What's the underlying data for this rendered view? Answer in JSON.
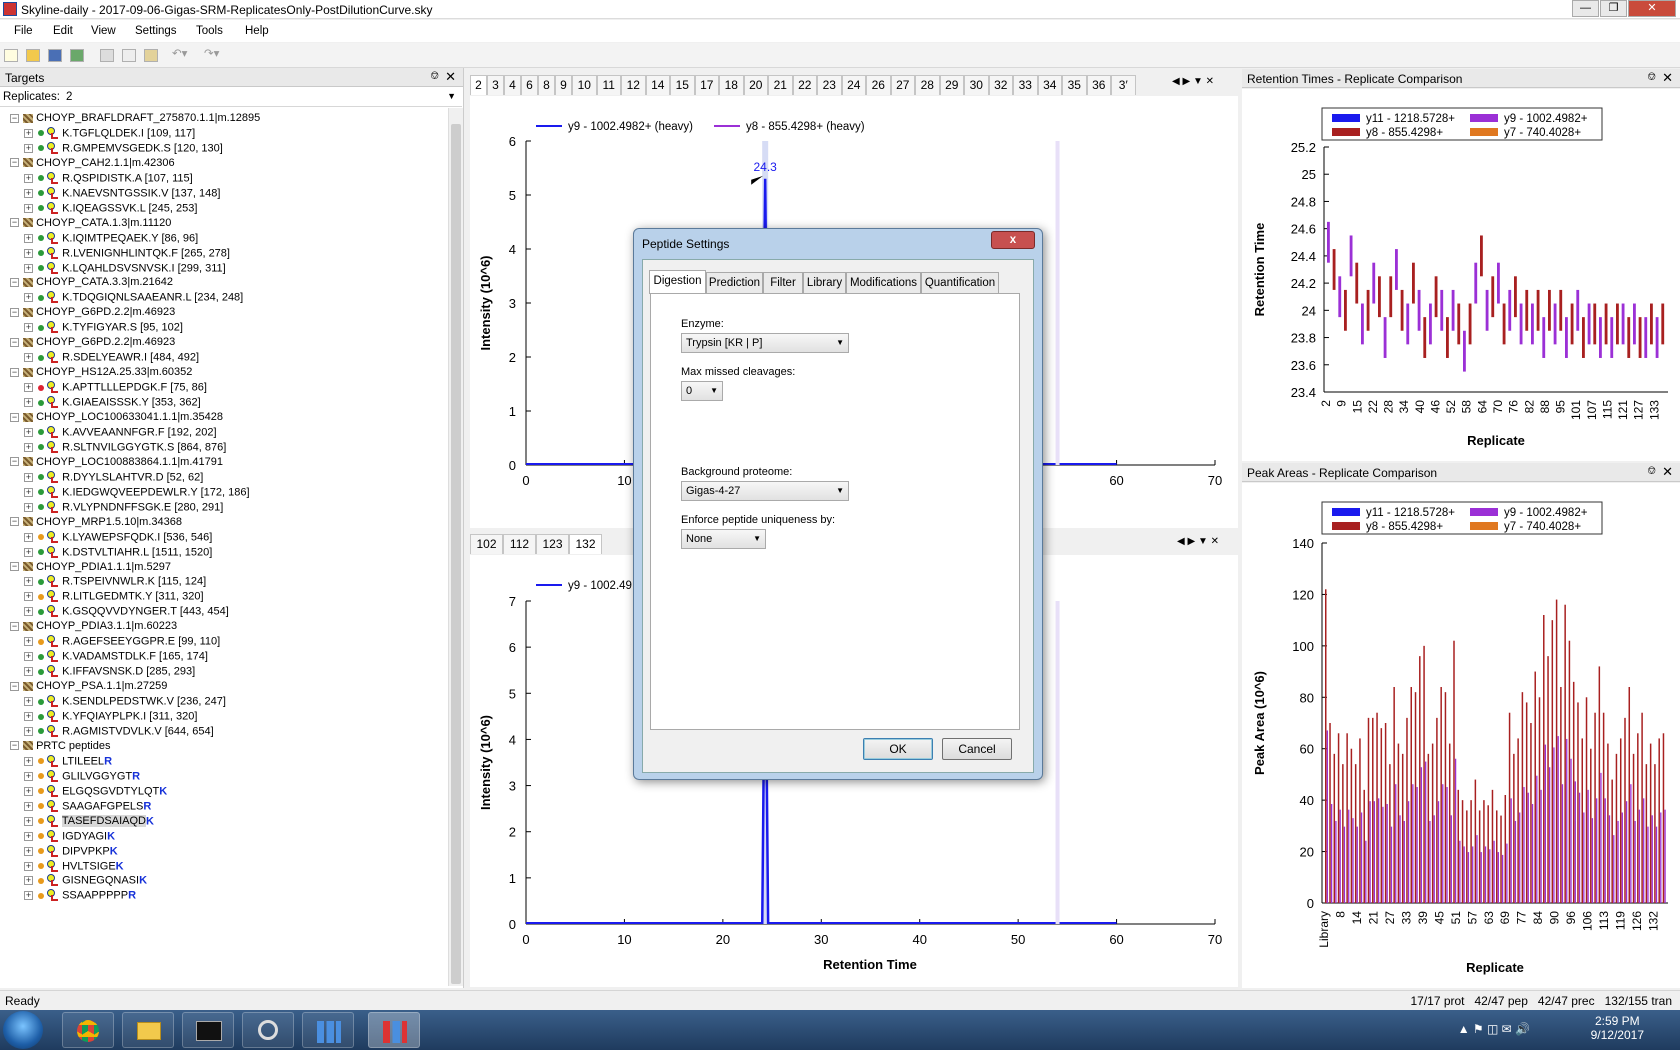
{
  "window": {
    "title": "Skyline-daily - 2017-09-06-Gigas-SRM-ReplicatesOnly-PostDilutionCurve.sky"
  },
  "menu": [
    "File",
    "Edit",
    "View",
    "Settings",
    "Tools",
    "Help"
  ],
  "targets": {
    "title": "Targets",
    "replicates_label": "Replicates:",
    "replicates_value": "2"
  },
  "tree": [
    {
      "kind": "prot",
      "text": "CHOYP_BRAFLDRAFT_275870.1.1|m.12895"
    },
    {
      "kind": "pep",
      "dot": "g",
      "text": "K.TGFLQLDEK.I [109, 117]"
    },
    {
      "kind": "pep",
      "dot": "g",
      "text": "R.GMPEMVSGEDK.S [120, 130]"
    },
    {
      "kind": "prot",
      "text": "CHOYP_CAH2.1.1|m.42306"
    },
    {
      "kind": "pep",
      "dot": "g",
      "text": "R.QSPIDISTK.A [107, 115]"
    },
    {
      "kind": "pep",
      "dot": "g",
      "text": "K.NAEVSNTGSSIK.V [137, 148]"
    },
    {
      "kind": "pep",
      "dot": "g",
      "text": "K.IQEAGSSVK.L [245, 253]"
    },
    {
      "kind": "prot",
      "text": "CHOYP_CATA.1.3|m.11120"
    },
    {
      "kind": "pep",
      "dot": "g",
      "text": "K.IQIMTPEQAEK.Y [86, 96]"
    },
    {
      "kind": "pep",
      "dot": "g",
      "text": "R.LVENIGNHLINTQK.F [265, 278]"
    },
    {
      "kind": "pep",
      "dot": "g",
      "text": "K.LQAHLDSVSNVSK.I [299, 311]"
    },
    {
      "kind": "prot",
      "text": "CHOYP_CATA.3.3|m.21642"
    },
    {
      "kind": "pep",
      "dot": "g",
      "text": "K.TDQGIQNLSAAEANR.L [234, 248]"
    },
    {
      "kind": "prot",
      "text": "CHOYP_G6PD.2.2|m.46923"
    },
    {
      "kind": "pep",
      "dot": "g",
      "text": "K.TYFIGYAR.S [95, 102]"
    },
    {
      "kind": "prot",
      "text": "CHOYP_G6PD.2.2|m.46923"
    },
    {
      "kind": "pep",
      "dot": "g",
      "text": "R.SDELYEAWR.I [484, 492]"
    },
    {
      "kind": "prot",
      "text": "CHOYP_HS12A.25.33|m.60352"
    },
    {
      "kind": "pep",
      "dot": "r",
      "text": "K.APTTLLLEPDGK.F [75, 86]"
    },
    {
      "kind": "pep",
      "dot": "g",
      "text": "K.GIAEAISSSK.Y [353, 362]"
    },
    {
      "kind": "prot",
      "text": "CHOYP_LOC100633041.1.1|m.35428"
    },
    {
      "kind": "pep",
      "dot": "g",
      "text": "K.AVVEAANNFGR.F [192, 202]"
    },
    {
      "kind": "pep",
      "dot": "g",
      "text": "R.SLTNVILGGYGTK.S [864, 876]"
    },
    {
      "kind": "prot",
      "text": "CHOYP_LOC100883864.1.1|m.41791"
    },
    {
      "kind": "pep",
      "dot": "g",
      "text": "R.DYYLSLAHTVR.D [52, 62]"
    },
    {
      "kind": "pep",
      "dot": "g",
      "text": "K.IEDGWQVEEPDEWLR.Y [172, 186]"
    },
    {
      "kind": "pep",
      "dot": "g",
      "text": "R.VLYPNDNFFSGK.E [280, 291]"
    },
    {
      "kind": "prot",
      "text": "CHOYP_MRP1.5.10|m.34368"
    },
    {
      "kind": "pep",
      "dot": "o",
      "text": "K.LYAWEPSFQDK.I [536, 546]"
    },
    {
      "kind": "pep",
      "dot": "g",
      "text": "K.DSTVLTIAHR.L [1511, 1520]"
    },
    {
      "kind": "prot",
      "text": "CHOYP_PDIA1.1.1|m.5297"
    },
    {
      "kind": "pep",
      "dot": "g",
      "text": "R.TSPEIVNWLR.K [115, 124]"
    },
    {
      "kind": "pep",
      "dot": "o",
      "text": "R.LITLGEDMTK.Y [311, 320]"
    },
    {
      "kind": "pep",
      "dot": "g",
      "text": "K.GSQQVVDYNGER.T [443, 454]"
    },
    {
      "kind": "prot",
      "text": "CHOYP_PDIA3.1.1|m.60223"
    },
    {
      "kind": "pep",
      "dot": "o",
      "text": "R.AGEFSEEYGGPR.E [99, 110]"
    },
    {
      "kind": "pep",
      "dot": "g",
      "text": "K.VADAMSTDLK.F [165, 174]"
    },
    {
      "kind": "pep",
      "dot": "g",
      "text": "K.IFFAVSNSK.D [285, 293]"
    },
    {
      "kind": "prot",
      "text": "CHOYP_PSA.1.1|m.27259"
    },
    {
      "kind": "pep",
      "dot": "g",
      "text": "K.SENDLPEDSTWK.V [236, 247]"
    },
    {
      "kind": "pep",
      "dot": "g",
      "text": "K.YFQIAYPLPK.I [311, 320]"
    },
    {
      "kind": "pep",
      "dot": "g",
      "text": "R.AGMISTVDVLK.V [644, 654]"
    },
    {
      "kind": "prot",
      "text": "PRTC peptides"
    },
    {
      "kind": "prtc",
      "dot": "o",
      "text": "LTILEEL",
      "end": "R"
    },
    {
      "kind": "prtc",
      "dot": "o",
      "text": "GLILVGGYGT",
      "end": "R"
    },
    {
      "kind": "prtc",
      "dot": "o",
      "text": "ELGQSGVDTYLQT",
      "end": "K"
    },
    {
      "kind": "prtc",
      "dot": "o",
      "text": "SAAGAFGPELS",
      "end": "R"
    },
    {
      "kind": "prtc",
      "dot": "o",
      "text": "TASEFDSAIAQD",
      "end": "K",
      "sel": true
    },
    {
      "kind": "prtc",
      "dot": "o",
      "text": "IGDYAGI",
      "end": "K"
    },
    {
      "kind": "prtc",
      "dot": "o",
      "text": "DIPVPKP",
      "end": "K"
    },
    {
      "kind": "prtc",
      "dot": "o",
      "text": "HVLTSIGE",
      "end": "K"
    },
    {
      "kind": "prtc",
      "dot": "o",
      "text": "GISNEGQNASI",
      "end": "K"
    },
    {
      "kind": "prtc",
      "dot": "o",
      "text": "SSAAPPPPP",
      "end": "R"
    }
  ],
  "top_tabs": [
    "2",
    "3",
    "4",
    "6",
    "8",
    "9",
    "10",
    "11",
    "12",
    "14",
    "15",
    "17",
    "18",
    "20",
    "21",
    "22",
    "23",
    "24",
    "26",
    "27",
    "28",
    "29",
    "30",
    "32",
    "33",
    "34",
    "35",
    "36",
    "3′"
  ],
  "bottom_tabs": [
    "102",
    "112",
    "123",
    "132"
  ],
  "chrom_top": {
    "legend": [
      "y9 - 1002.4982+ (heavy)",
      "y8 - 855.4298+ (heavy)"
    ],
    "ylabel": "Intensity (10^6)",
    "yticks": [
      "0",
      "1",
      "2",
      "3",
      "4",
      "5",
      "6"
    ],
    "xticks": [
      "0",
      "10",
      "20",
      "30",
      "40",
      "50",
      "60",
      "70"
    ],
    "peak_label": "24.3",
    "peak_rt": 24.3,
    "peak_height": 5.3,
    "colors": {
      "y9": "#1a1aee",
      "y8": "#9b30d6"
    }
  },
  "chrom_bottom": {
    "legend": [
      "y9 - 1002.49"
    ],
    "ylabel": "Intensity (10^6)",
    "xlabel": "Retention Time",
    "yticks": [
      "0",
      "1",
      "2",
      "3",
      "4",
      "5",
      "6",
      "7"
    ],
    "xticks": [
      "0",
      "10",
      "20",
      "30",
      "40",
      "50",
      "60",
      "70"
    ],
    "peak_rt": 24.3,
    "peak_height": 7.0
  },
  "rt_panel": {
    "title": "Retention Times - Replicate Comparison"
  },
  "area_panel": {
    "title": "Peak Areas - Replicate Comparison"
  },
  "chart_data": [
    {
      "type": "line",
      "title": "",
      "xlabel": "Retention Time",
      "ylabel": "Intensity (10^6)",
      "xlim": [
        0,
        70
      ],
      "ylim": [
        0,
        6
      ],
      "series": [
        {
          "name": "y9 - 1002.4982+ (heavy)",
          "x": [
            0,
            23.8,
            24.3,
            24.8,
            60
          ],
          "y": [
            0,
            0,
            5.3,
            0,
            0
          ]
        },
        {
          "name": "y8 - 855.4298+ (heavy)",
          "x": [
            0,
            60
          ],
          "y": [
            0,
            0
          ]
        }
      ],
      "annotations": [
        "24.3"
      ]
    },
    {
      "type": "line",
      "title": "",
      "xlabel": "Retention Time",
      "ylabel": "Intensity (10^6)",
      "xlim": [
        0,
        70
      ],
      "ylim": [
        0,
        7
      ],
      "series": [
        {
          "name": "y9 - 1002.49",
          "x": [
            0,
            23.9,
            24.3,
            24.7,
            60
          ],
          "y": [
            0,
            0,
            7.0,
            0,
            0
          ]
        }
      ]
    },
    {
      "type": "bar",
      "title": "",
      "xlabel": "Replicate",
      "ylabel": "Retention Time",
      "ylim": [
        23.4,
        25.2
      ],
      "yticks": [
        "23.4",
        "23.6",
        "23.8",
        "24",
        "24.2",
        "24.4",
        "24.6",
        "24.8",
        "25",
        "25.2"
      ],
      "xticks": [
        "2",
        "9",
        "15",
        "22",
        "28",
        "34",
        "40",
        "46",
        "52",
        "58",
        "64",
        "70",
        "76",
        "82",
        "88",
        "95",
        "101",
        "107",
        "115",
        "121",
        "127",
        "133"
      ],
      "legend": [
        "y11 - 1218.5728+",
        "y9 - 1002.4982+",
        "y8 - 855.4298+",
        "y7 - 740.4028+"
      ],
      "colors": [
        "#1a1aee",
        "#9b30d6",
        "#a82020",
        "#e07820"
      ],
      "values": [
        24.5,
        24.3,
        24.1,
        24.0,
        24.4,
        24.2,
        23.9,
        24.0,
        24.2,
        24.1,
        23.8,
        24.1,
        24.3,
        24.0,
        23.9,
        24.2,
        24.0,
        23.8,
        23.9,
        24.1,
        24.0,
        23.8,
        24.0,
        23.9,
        23.7,
        23.9,
        24.2,
        24.4,
        24.0,
        24.1,
        24.2,
        23.9,
        24.0,
        24.1,
        23.9,
        24.0,
        23.9,
        24.0,
        23.8,
        24.0,
        23.9,
        24.0,
        23.8,
        23.9,
        24.0,
        23.8,
        23.9,
        23.9,
        23.8,
        23.9,
        23.8,
        23.9,
        23.9,
        23.8,
        23.9,
        23.8,
        23.8,
        23.9,
        23.8,
        23.9
      ]
    },
    {
      "type": "bar",
      "title": "",
      "xlabel": "Replicate",
      "ylabel": "Peak Area (10^6)",
      "ylim": [
        0,
        140
      ],
      "yticks": [
        "0",
        "20",
        "40",
        "60",
        "80",
        "100",
        "120",
        "140"
      ],
      "xticks": [
        "Library",
        "8",
        "14",
        "21",
        "27",
        "33",
        "39",
        "45",
        "51",
        "57",
        "63",
        "69",
        "77",
        "84",
        "90",
        "96",
        "106",
        "113",
        "119",
        "126",
        "132"
      ],
      "legend": [
        "y11 - 1218.5728+",
        "y9 - 1002.4982+",
        "y8 - 855.4298+",
        "y7 - 740.4028+"
      ],
      "colors": [
        "#1a1aee",
        "#9b30d6",
        "#a82020",
        "#e07820"
      ],
      "values": [
        122,
        70,
        58,
        66,
        54,
        66,
        60,
        54,
        64,
        44,
        72,
        72,
        74,
        68,
        70,
        54,
        84,
        62,
        58,
        72,
        84,
        82,
        96,
        100,
        58,
        62,
        72,
        84,
        82,
        62,
        102,
        44,
        40,
        36,
        40,
        48,
        36,
        40,
        38,
        44,
        36,
        34,
        42,
        74,
        58,
        64,
        82,
        78,
        70,
        90,
        80,
        112,
        96,
        110,
        118,
        84,
        116,
        102,
        86,
        78,
        64,
        80,
        60,
        74,
        92,
        74,
        62,
        48,
        58,
        64,
        72,
        84,
        58,
        66,
        74,
        54,
        62,
        54,
        64,
        66
      ]
    }
  ],
  "dialog": {
    "title": "Peptide Settings",
    "close": "x",
    "tabs": [
      "Digestion",
      "Prediction",
      "Filter",
      "Library",
      "Modifications",
      "Quantification"
    ],
    "enzyme_label": "Enzyme:",
    "enzyme_value": "Trypsin [KR | P]",
    "missed_label": "Max missed cleavages:",
    "missed_value": "0",
    "bg_label": "Background proteome:",
    "bg_value": "Gigas-4-27",
    "unique_label": "Enforce peptide uniqueness by:",
    "unique_value": "None",
    "ok": "OK",
    "cancel": "Cancel"
  },
  "status": {
    "left": "Ready",
    "right": "17/17 prot   42/47 pep   42/47 prec   132/155 tran"
  },
  "clock": {
    "time": "2:59 PM",
    "date": "9/12/2017"
  }
}
